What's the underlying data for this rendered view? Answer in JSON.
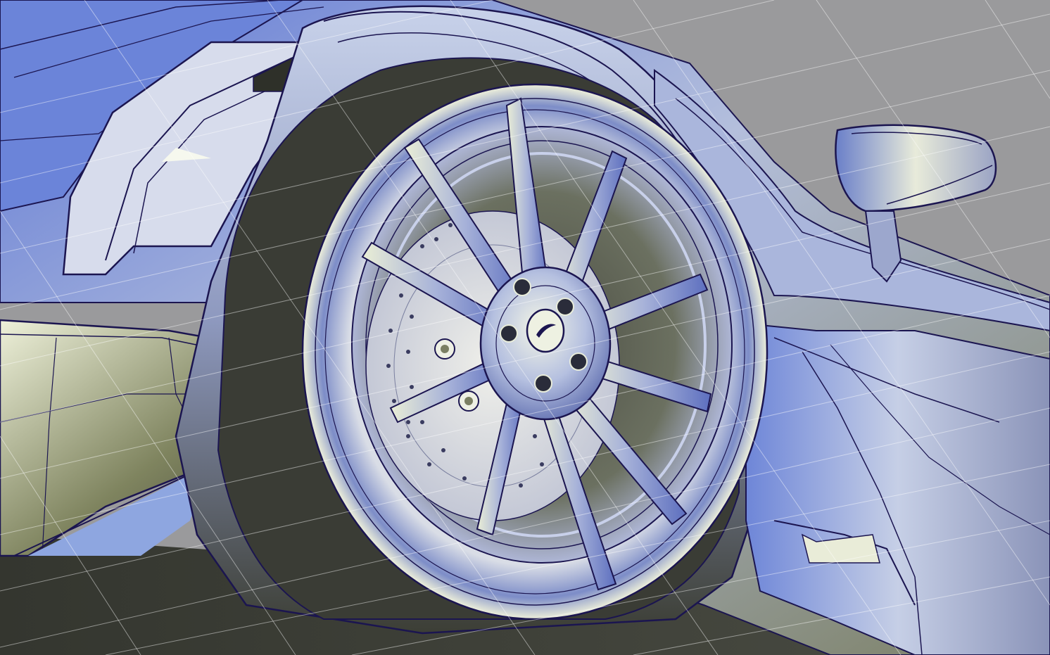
{
  "viewport": {
    "kind": "cad-render",
    "subject": "car-wheel-surface-model",
    "background_color": "#9a9a9c",
    "grid_color": "#ffffff",
    "isoparm_color": "#1b1550",
    "shade_colors": {
      "light": "#f3f6e4",
      "blue": "#5f78d6",
      "mid": "#b4bfdc",
      "dark": "#34362f",
      "olive": "#7b7f63"
    },
    "wheel": {
      "spoke_count": 10,
      "lug_nut_count": 5,
      "center_badge": "swoosh-logo"
    }
  }
}
